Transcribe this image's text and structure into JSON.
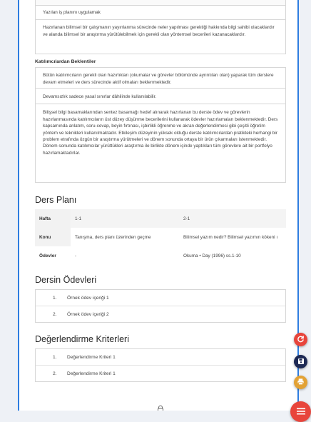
{
  "objectives_tail": [
    "Yazılan iş planını uygulamak",
    "Hazırlanan bilimsel bir çalışmanın yayınlanma sürecinde neler yapılması gerektiği hakkında bilgi sahibi olacaklardır ve alanda bilimsel bir araştırma yürütülebilmek için gerekli olan yöntemsel becerileri kazanacaklardır."
  ],
  "expectations": {
    "title": "Katılımcılardan Beklentiler",
    "items": [
      "Bütün katılımcıların gerekli olan hazırlıkları (okumalar ve görevler bölümünde ayrıntıları olan) yaparak tüm derslere devam etmeleri ve ders sürecinde aktif olmaları beklenmektedir.",
      "Devamsızlık sadece yasal sınırlar dâhilinde kullanılabilir.",
      "Bilişsel bilgi basamaklarından sentez basamağı hedef alınarak hazırlanan bu derste ödev ve görevlerin hazırlanmasında katılımcıların üst düzey düşünme becerilerini kullanarak ödevler hazırlamaları beklenmektedir. Ders kapsamında anlatım, soru-cevap, beyin fırtınası, işbirlikli öğrenme ve akran değerlendirmesi gibi çeşitli öğretim yöntem ve teknikleri kullanılmaktadır. Etkileşim düzeyinin yüksek olduğu derste katılımcılardan pratikteki herhangi bir problem etrafında özgün bir araştırma yürütmeleri ve dönem sonunda ortaya bir ürün çıkarmaları istenmektedir. Dönem sonunda katılımcılar yürüttükleri araştırma ile birlikte dönem içinde yaptıkları tüm görevlere ait bir portfolyo hazırlamaktadırlar."
    ]
  },
  "plan": {
    "title": "Ders Planı",
    "rows": [
      {
        "label": "Hafta",
        "c1": "1-1",
        "c2": "2-1"
      },
      {
        "label": "Konu",
        "c1": "Tanışma, ders planı üzerinden geçme",
        "c2": "Bilimsel yazım nedir? Bilimsel yazımın kökeni ı"
      },
      {
        "label": "Ödevler",
        "c1": "-",
        "c2": "Okuma • Day (1996) ss.1-10"
      }
    ]
  },
  "homework": {
    "title": "Dersin Ödevleri",
    "items": [
      {
        "num": "1.",
        "text": "Örnek ödev içeriği 1"
      },
      {
        "num": "2.",
        "text": "Örnek ödev içeriği 2"
      }
    ]
  },
  "criteria": {
    "title": "Değerlendirme Kriterleri",
    "items": [
      {
        "num": "1.",
        "text": "Değerlendirme Kriteri 1"
      },
      {
        "num": "2.",
        "text": "Değerlendirme Kriteri 1"
      }
    ]
  },
  "fab_colors": {
    "refresh": "#e8453c",
    "save": "#1e2a55",
    "print": "#e3a235",
    "menu": "#e8453c"
  },
  "icons": {
    "refresh": "refresh-icon",
    "save": "save-icon",
    "print": "print-icon",
    "menu": "menu-icon",
    "lock": "lock-icon"
  }
}
